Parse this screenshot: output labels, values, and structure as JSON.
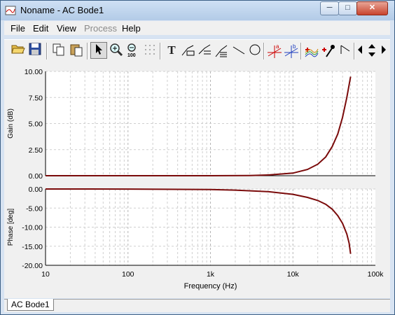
{
  "window": {
    "title": "Noname - AC Bode1"
  },
  "title_controls": {
    "minimize": "─",
    "maximize": "□",
    "close": "✕"
  },
  "menu": [
    "File",
    "Edit",
    "View",
    "Process",
    "Help"
  ],
  "toolbar": {
    "tools": [
      "open-icon",
      "save-icon",
      "copy-icon",
      "paste-icon",
      "select-arrow-icon",
      "zoom-in-icon",
      "zoom-100-icon",
      "grid-icon",
      "text-tool-icon",
      "label-icon",
      "label-multi-icon",
      "annotation-icon",
      "line-tool-icon",
      "ellipse-tool-icon",
      "cursor-a-icon",
      "cursor-b-icon",
      "add-trace-icon",
      "eyedropper-icon",
      "step-icon",
      "arrow-left-icon",
      "arrow-updown-icon",
      "arrow-right-icon"
    ],
    "glyphs": {
      "text_tool": "T",
      "zoom_100": "100"
    }
  },
  "chart_data": [
    {
      "type": "line",
      "ylabel": "Gain (dB)",
      "xscale": "log",
      "xlim": [
        10,
        100000
      ],
      "ylim": [
        0,
        10
      ],
      "yticks": [
        "0.00",
        "2.50",
        "5.00",
        "7.50",
        "10.00"
      ],
      "grid": true,
      "line_color": "#7a0a0a",
      "series": [
        {
          "x": [
            10,
            100,
            1000,
            3000,
            5000,
            10000,
            15000,
            20000,
            25000,
            30000,
            35000,
            40000,
            45000,
            50000
          ],
          "y": [
            0.0,
            0.0,
            0.0,
            0.02,
            0.07,
            0.25,
            0.6,
            1.1,
            1.8,
            2.8,
            4.0,
            5.6,
            7.5,
            9.5
          ]
        }
      ]
    },
    {
      "type": "line",
      "ylabel": "Phase [deg]",
      "xlabel": "Frequency (Hz)",
      "xscale": "log",
      "xlim": [
        10,
        100000
      ],
      "ylim": [
        -20,
        0
      ],
      "yticks": [
        "0.00",
        "-5.00",
        "-10.00",
        "-15.00",
        "-20.00"
      ],
      "xticks": [
        "10",
        "100",
        "1k",
        "10k",
        "100k"
      ],
      "grid": true,
      "line_color": "#7a0a0a",
      "series": [
        {
          "x": [
            10,
            100,
            1000,
            2000,
            5000,
            10000,
            15000,
            20000,
            25000,
            30000,
            35000,
            40000,
            45000,
            48000,
            50000
          ],
          "y": [
            0.0,
            -0.02,
            -0.15,
            -0.3,
            -0.7,
            -1.4,
            -2.2,
            -3.0,
            -4.0,
            -5.3,
            -7.0,
            -9.0,
            -11.8,
            -14.2,
            -17.0
          ]
        }
      ]
    }
  ],
  "tabs": [
    "AC Bode1"
  ]
}
